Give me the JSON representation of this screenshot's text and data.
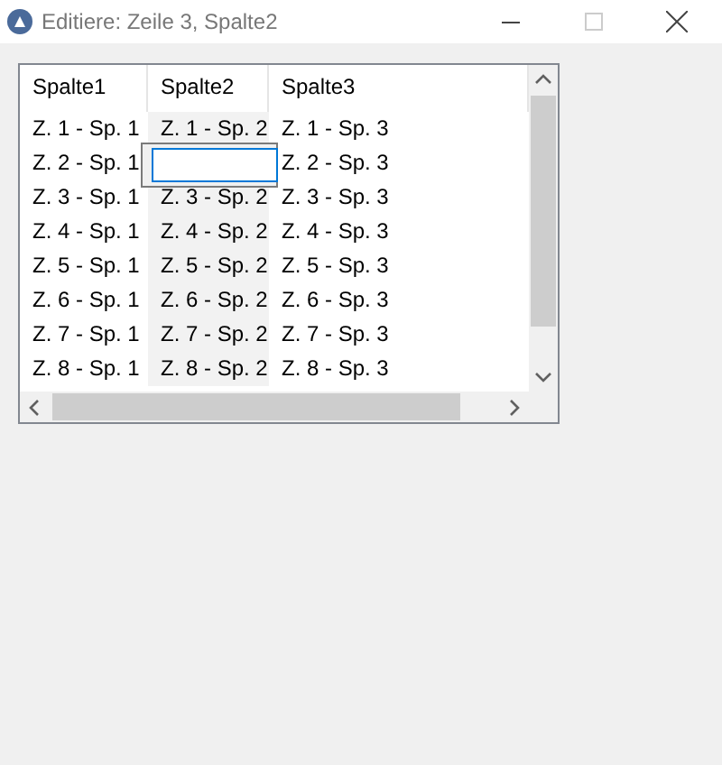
{
  "window": {
    "title": "Editiere: Zeile 3, Spalte2"
  },
  "table": {
    "columns": [
      {
        "label": "Spalte1",
        "sorted": false
      },
      {
        "label": "Spalte2",
        "sorted": true
      },
      {
        "label": "Spalte3",
        "sorted": false
      }
    ],
    "rows": [
      {
        "cells": [
          {
            "kind": "text",
            "text": "Z. 1 - Sp. 1"
          },
          {
            "kind": "text",
            "text": "Z. 1 - Sp. 2"
          },
          {
            "kind": "text",
            "text": "Z. 1 - Sp. 3"
          }
        ]
      },
      {
        "cells": [
          {
            "kind": "text",
            "text": "Z. 2 - Sp. 1"
          },
          {
            "kind": "editor"
          },
          {
            "kind": "text",
            "text": "Z. 2 - Sp. 3"
          }
        ]
      },
      {
        "cells": [
          {
            "kind": "text",
            "text": "Z. 3 - Sp. 1"
          },
          {
            "kind": "text",
            "text": "Z. 3 - Sp. 2"
          },
          {
            "kind": "text",
            "text": "Z. 3 - Sp. 3"
          }
        ]
      },
      {
        "cells": [
          {
            "kind": "text",
            "text": "Z. 4 - Sp. 1"
          },
          {
            "kind": "text",
            "text": "Z. 4 - Sp. 2"
          },
          {
            "kind": "text",
            "text": "Z. 4 - Sp. 3"
          }
        ]
      },
      {
        "cells": [
          {
            "kind": "text",
            "text": "Z. 5 - Sp. 1"
          },
          {
            "kind": "text",
            "text": "Z. 5 - Sp. 2"
          },
          {
            "kind": "text",
            "text": "Z. 5 - Sp. 3"
          }
        ]
      },
      {
        "cells": [
          {
            "kind": "text",
            "text": "Z. 6 - Sp. 1"
          },
          {
            "kind": "text",
            "text": "Z. 6 - Sp. 2"
          },
          {
            "kind": "text",
            "text": "Z. 6 - Sp. 3"
          }
        ]
      },
      {
        "cells": [
          {
            "kind": "text",
            "text": "Z. 7 - Sp. 1"
          },
          {
            "kind": "text",
            "text": "Z. 7 - Sp. 2"
          },
          {
            "kind": "text",
            "text": "Z. 7 - Sp. 3"
          }
        ]
      },
      {
        "cells": [
          {
            "kind": "text",
            "text": "Z. 8 - Sp. 1"
          },
          {
            "kind": "text",
            "text": "Z. 8 - Sp. 2"
          },
          {
            "kind": "text",
            "text": "Z. 8 - Sp. 3"
          }
        ]
      }
    ]
  }
}
